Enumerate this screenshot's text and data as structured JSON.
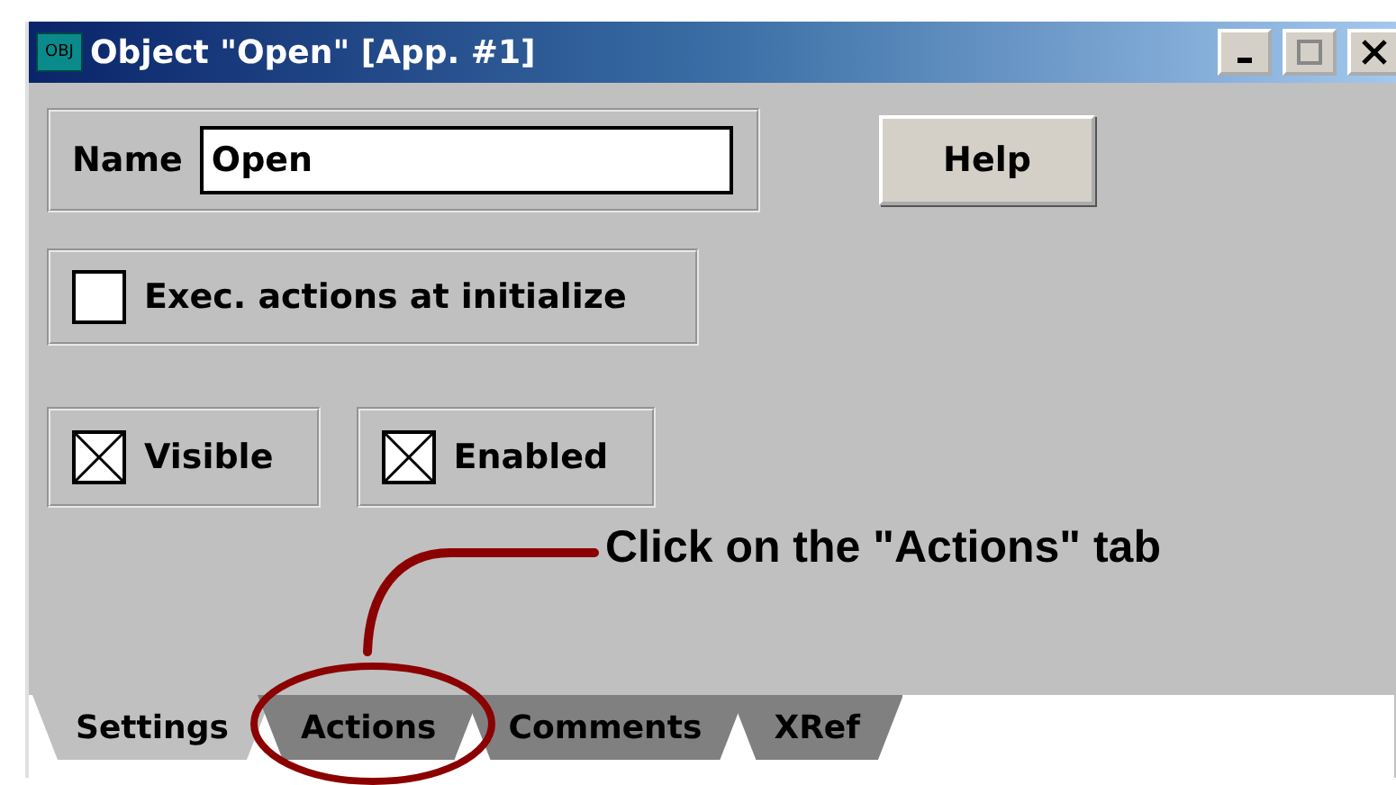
{
  "window": {
    "icon_label": "OBJ",
    "title": "Object \"Open\" [App. #1]"
  },
  "name_field": {
    "label": "Name",
    "value": "Open"
  },
  "help_button": {
    "label": "Help"
  },
  "options": [
    {
      "label": "Exec. actions at initialize",
      "checked": false
    },
    {
      "label": "Visible",
      "checked": true
    },
    {
      "label": "Enabled",
      "checked": true
    }
  ],
  "tabs": [
    {
      "label": "Settings",
      "selected": true
    },
    {
      "label": "Actions",
      "selected": false
    },
    {
      "label": "Comments",
      "selected": false
    },
    {
      "label": "XRef",
      "selected": false
    }
  ],
  "callout": {
    "text": "Click on the \"Actions\" tab"
  }
}
